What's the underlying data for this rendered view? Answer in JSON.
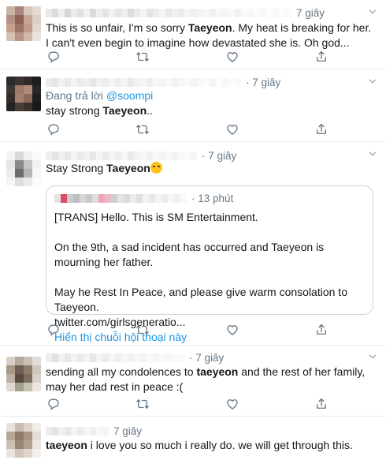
{
  "tweets": [
    {
      "time": "7 giây",
      "text_parts": [
        "This is so unfair, I'm so sorry ",
        "Taeyeon",
        ". My heat is breaking for her. I can't even begin to imagine how devastated she is. Oh god..."
      ]
    },
    {
      "time": "· 7 giây",
      "reply_prefix": "Đang trả lời ",
      "reply_handle": "@soompi",
      "text_parts": [
        "stay strong ",
        "Taeyeon",
        ".."
      ]
    },
    {
      "time": "· 7 giây",
      "text_parts": [
        "Stay Strong ",
        "Taeyeon",
        ""
      ],
      "emoji": "crying-face-emoji",
      "quote": {
        "time": "· 13 phút",
        "line1": "[TRANS] Hello. This is SM Entertainment.",
        "line2": "On the 9th, a sad incident has occurred and Taeyeon is mourning her father.",
        "line3": "May he Rest In Peace, and please give  warm consolation to Taeyeon.",
        "line4": "twitter.com/girlsgeneratio...",
        "thread_link": "Hiển thị chuỗi hội thoại này"
      }
    },
    {
      "time": "· 7 giây",
      "text_parts": [
        "sending all my condolences to ",
        "taeyeon",
        " and the rest of her family, may her dad rest in peace :("
      ]
    },
    {
      "time": "7 giây",
      "text_parts": [
        "taeyeon",
        " i love you so much i really do. we will get through this."
      ]
    }
  ],
  "icons": {
    "reply": "reply-icon",
    "retweet": "retweet-icon",
    "like": "like-icon",
    "share": "share-icon",
    "more": "chevron-down-icon"
  },
  "colors": {
    "link": "#1b95e0",
    "muted": "#657786",
    "divider": "#e6ecf0",
    "icon": "#657786"
  }
}
